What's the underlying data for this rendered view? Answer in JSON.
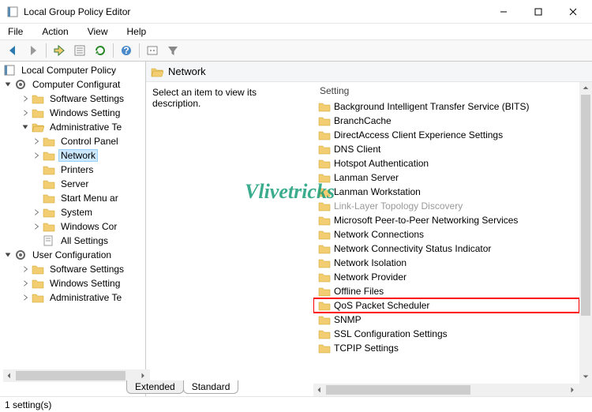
{
  "window": {
    "title": "Local Group Policy Editor"
  },
  "menu": {
    "file": "File",
    "action": "Action",
    "view": "View",
    "help": "Help"
  },
  "tree": {
    "root": "Local Computer Policy",
    "cc": "Computer Configurat",
    "cc_soft": "Software Settings",
    "cc_win": "Windows Setting",
    "cc_admin": "Administrative Te",
    "cc_cp": "Control Panel",
    "cc_net": "Network",
    "cc_prn": "Printers",
    "cc_srv": "Server",
    "cc_start": "Start Menu ar",
    "cc_sys": "System",
    "cc_wincor": "Windows Cor",
    "cc_all": "All Settings",
    "uc": "User Configuration",
    "uc_soft": "Software Settings",
    "uc_win": "Windows Setting",
    "uc_admin": "Administrative Te"
  },
  "detail": {
    "title": "Network",
    "desc": "Select an item to view its description.",
    "column": "Setting",
    "items": [
      "Background Intelligent Transfer Service (BITS)",
      "BranchCache",
      "DirectAccess Client Experience Settings",
      "DNS Client",
      "Hotspot Authentication",
      "Lanman Server",
      "Lanman Workstation",
      "Link-Layer Topology Discovery",
      "Microsoft Peer-to-Peer Networking Services",
      "Network Connections",
      "Network Connectivity Status Indicator",
      "Network Isolation",
      "Network Provider",
      "Offline Files",
      "QoS Packet Scheduler",
      "SNMP",
      "SSL Configuration Settings",
      "TCPIP Settings"
    ],
    "highlight_index": 14
  },
  "tabs": {
    "extended": "Extended",
    "standard": "Standard"
  },
  "status": "1 setting(s)",
  "watermark": "Vlivetricks"
}
